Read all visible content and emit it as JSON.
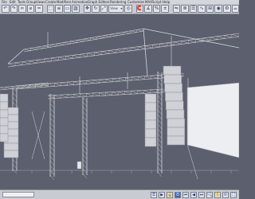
{
  "menu": {
    "items": [
      "File",
      "Edit",
      "Tools",
      "Group",
      "Views",
      "Create",
      "Modifiers",
      "Animation",
      "Graph Editors",
      "Rendering",
      "Customize",
      "MAXScript",
      "Help"
    ]
  },
  "toolbar": {
    "icons": [
      "undo-icon",
      "redo-icon",
      "link-icon",
      "unlink-icon",
      "bind-icon",
      "sep",
      "select-icon",
      "select-name-icon",
      "region-icon",
      "crossing-icon",
      "sep",
      "move-icon",
      "rotate-icon",
      "scale-icon",
      "dropdown",
      "pivot-icon",
      "sep",
      "snap-icon",
      "angle-snap-icon",
      "percent-snap-icon",
      "spinner-snap-icon",
      "sep",
      "mirror-icon",
      "align-icon",
      "layer-icon",
      "curve-icon",
      "schematic-icon",
      "material-icon",
      "render-setup-icon",
      "render-icon"
    ],
    "glyphs": [
      "↶",
      "↷",
      "∞",
      "⌀",
      "≈",
      "",
      "⬚",
      "≡",
      "▭",
      "▨",
      "",
      "✥",
      "↻",
      "⤢",
      "▾",
      "◎",
      "",
      "🧲",
      "∡",
      "%",
      "±",
      "",
      "⇋",
      "≣",
      "☰",
      "∿",
      "⊞",
      "◉",
      "⚙",
      "☕"
    ],
    "ref_dropdown": "View"
  },
  "viewport": {
    "label": ""
  },
  "statusbar": {
    "coord_label": "",
    "icons": [
      "key-icon",
      "play-icon",
      "lock-icon",
      "time-icon",
      "prev-frame-icon",
      "play-back-icon",
      "next-frame-icon",
      "zoom-icon",
      "pan-icon",
      "orbit-icon",
      "maximize-icon"
    ]
  },
  "colors": {
    "viewport_bg": "#5b5f6e",
    "wire": "#d8d8d8",
    "ui_bg": "#c9cbd2",
    "accent": "#3b64c8"
  }
}
